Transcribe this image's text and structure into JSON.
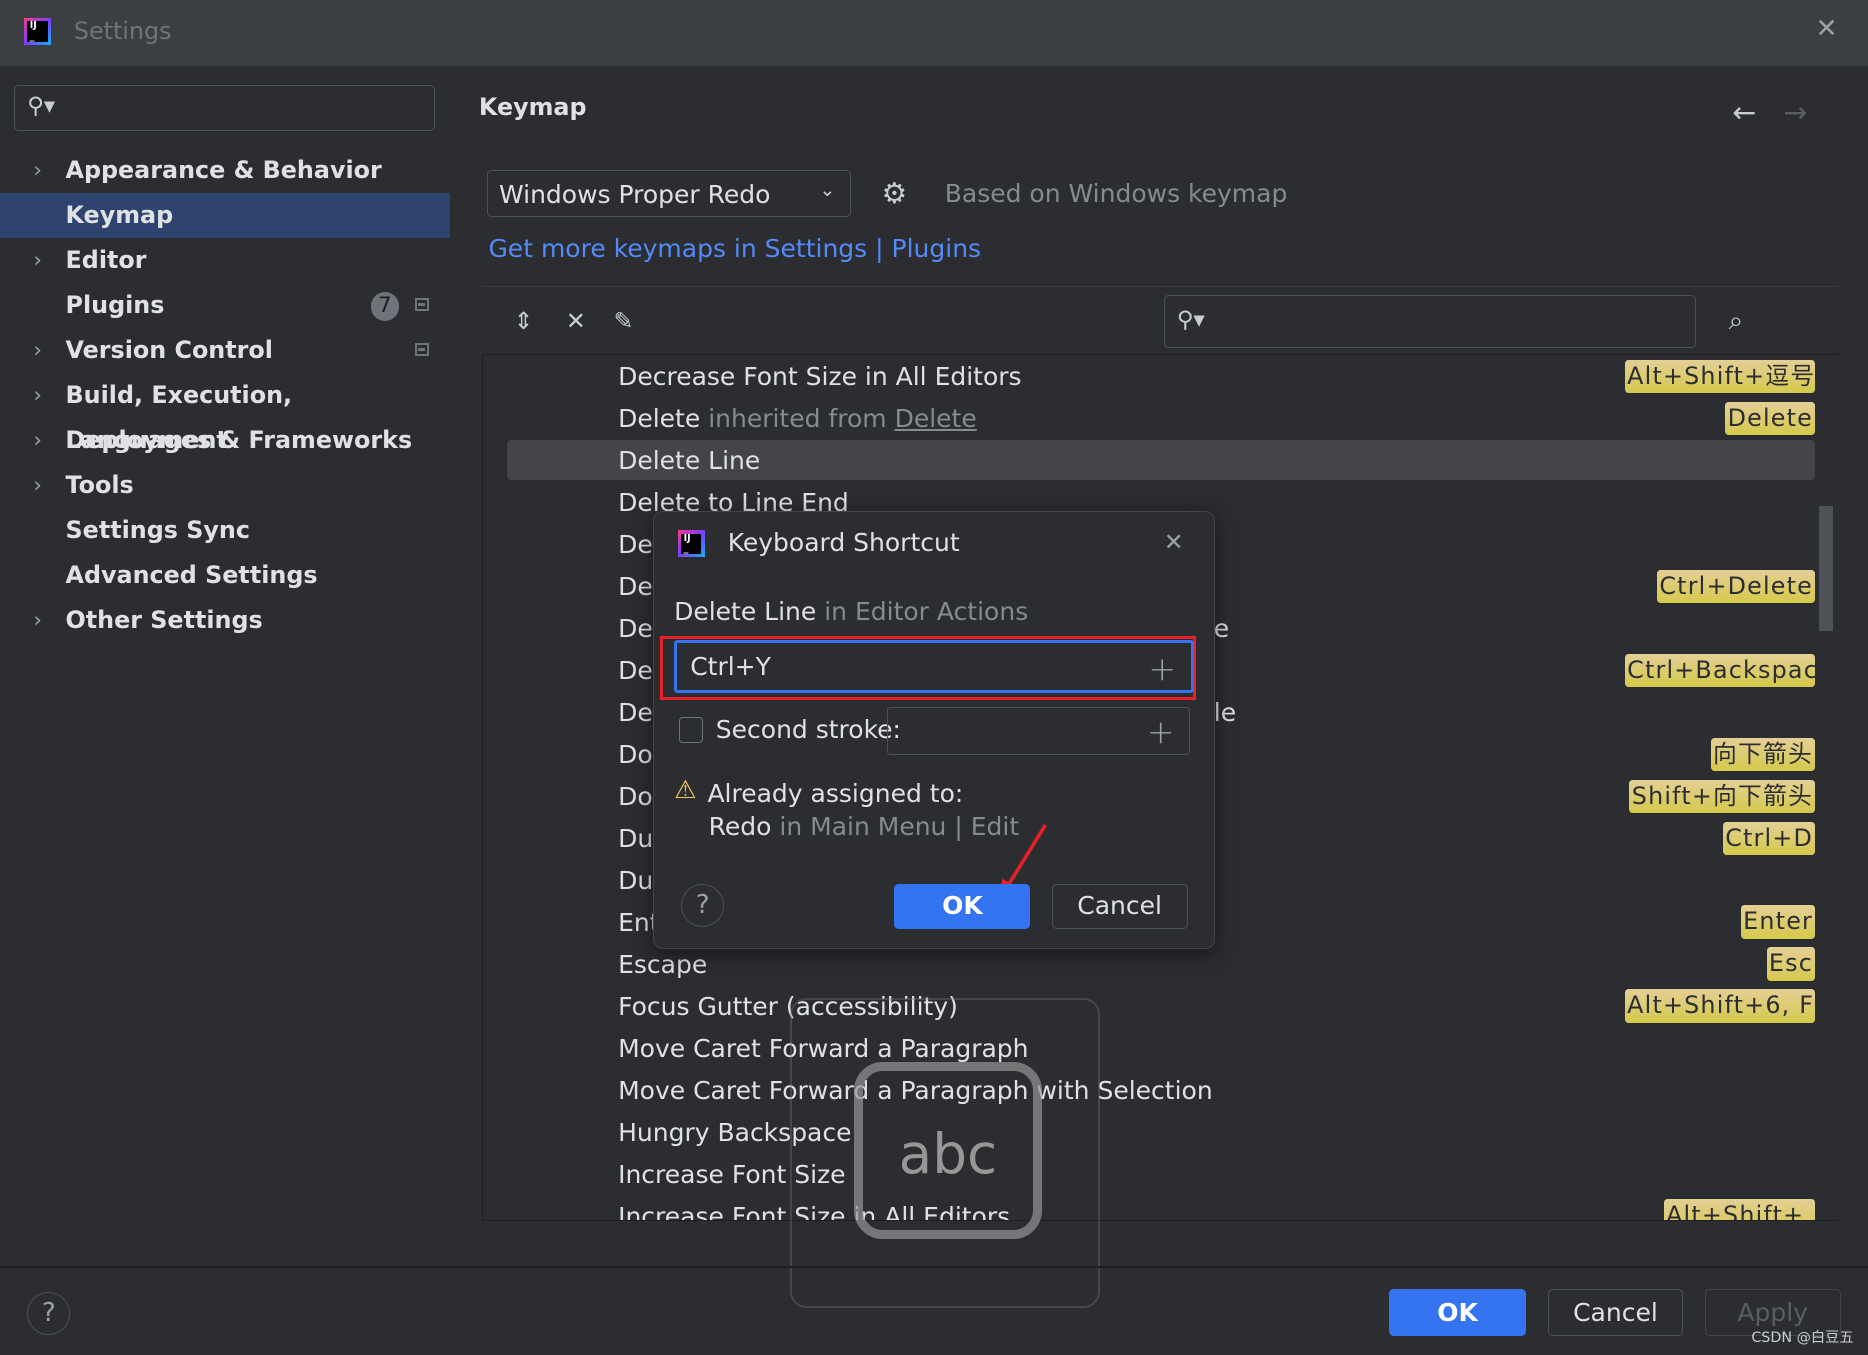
{
  "window": {
    "title": "Settings",
    "close_icon": "close-icon"
  },
  "sidebar": {
    "search_placeholder": "",
    "items": [
      {
        "label": "Appearance & Behavior",
        "expandable": true
      },
      {
        "label": "Keymap",
        "selected": true
      },
      {
        "label": "Editor",
        "expandable": true
      },
      {
        "label": "Plugins",
        "badge": "7"
      },
      {
        "label": "Version Control",
        "expandable": true
      },
      {
        "label": "Build, Execution, Deployment",
        "expandable": true
      },
      {
        "label": "Languages & Frameworks",
        "expandable": true
      },
      {
        "label": "Tools",
        "expandable": true
      },
      {
        "label": "Settings Sync"
      },
      {
        "label": "Advanced Settings"
      },
      {
        "label": "Other Settings",
        "expandable": true
      }
    ]
  },
  "main": {
    "title": "Keymap",
    "keymap_select": "Windows Proper Redo",
    "based_on": "Based on Windows keymap",
    "link": "Get more keymaps in Settings | Plugins",
    "actions": [
      {
        "name": "Decrease Font Size in All Editors",
        "shortcut": "Alt+Shift+逗号"
      },
      {
        "name": "Delete",
        "suffix": " inherited from ",
        "inherited": "Delete",
        "shortcut": "Delete"
      },
      {
        "name": "Delete Line",
        "selected": true
      },
      {
        "name": "Delete to Line End"
      },
      {
        "name": "Del"
      },
      {
        "name": "Del",
        "shortcut": "Ctrl+Delete"
      },
      {
        "name": "Del",
        "tail": "e"
      },
      {
        "name": "Del",
        "shortcut": "Ctrl+Backspace"
      },
      {
        "name": "Del",
        "tail": "le"
      },
      {
        "name": "Do",
        "shortcut": "向下箭头"
      },
      {
        "name": "Do",
        "shortcut": "Shift+向下箭头"
      },
      {
        "name": "Du",
        "shortcut": "Ctrl+D"
      },
      {
        "name": "Du"
      },
      {
        "name": "Ent",
        "shortcut": "Enter"
      },
      {
        "name": "Escape",
        "shortcut": "Esc"
      },
      {
        "name": "Focus Gutter (accessibility)",
        "shortcut": "Alt+Shift+6, F"
      },
      {
        "name": "Move Caret Forward a Paragraph"
      },
      {
        "name": "Move Caret Forward a Paragraph with Selection"
      },
      {
        "name": "Hungry Backspace"
      },
      {
        "name": "Increase Font Size"
      },
      {
        "name": "Increase Font Size in All Editors",
        "shortcut": "Alt+Shift+."
      }
    ]
  },
  "dialog": {
    "title": "Keyboard Shortcut",
    "action": "Delete Line",
    "context": " in Editor Actions",
    "first_stroke": "Ctrl+Y",
    "second_stroke_label": "Second stroke:",
    "second_stroke_value": "",
    "second_stroke_checked": false,
    "warning": "Already assigned to:",
    "conflict_action": "Redo",
    "conflict_context": " in Main Menu | Edit",
    "ok": "OK",
    "cancel": "Cancel",
    "help": "?"
  },
  "footer": {
    "help": "?",
    "ok": "OK",
    "cancel": "Cancel",
    "apply": "Apply"
  },
  "ime_indicator": "abc",
  "watermark": "CSDN @白豆五",
  "colors": {
    "accent": "#3574f0",
    "selection": "#2e436e",
    "shortcut_badge": "#d5c94b",
    "annotation": "#e8202a"
  }
}
